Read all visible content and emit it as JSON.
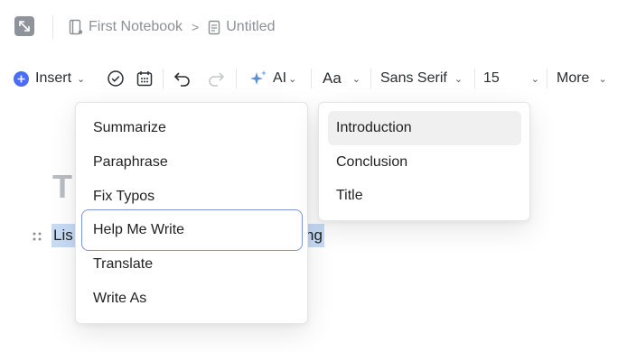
{
  "breadcrumb": {
    "notebook": "First Notebook",
    "page": "Untitled",
    "separator": ">"
  },
  "toolbar": {
    "insert_label": "Insert",
    "ai_label": "AI",
    "text_style_label": "Aa",
    "font_family": "Sans Serif",
    "font_size": "15",
    "more_label": "More"
  },
  "editor": {
    "heading_char": "T",
    "line_start": "Lis",
    "line_end": "ng"
  },
  "ai_menu": {
    "items": [
      "Summarize",
      "Paraphrase",
      "Fix Typos",
      "Help Me Write",
      "Translate",
      "Write As"
    ]
  },
  "help_write_submenu": {
    "items": [
      "Introduction",
      "Conclusion",
      "Title"
    ]
  },
  "colors": {
    "accent": "#4a6cf7",
    "ai_sparkle": "#5b8fd6",
    "selection": "#c7dbf5",
    "active_border": "#7d94db"
  }
}
